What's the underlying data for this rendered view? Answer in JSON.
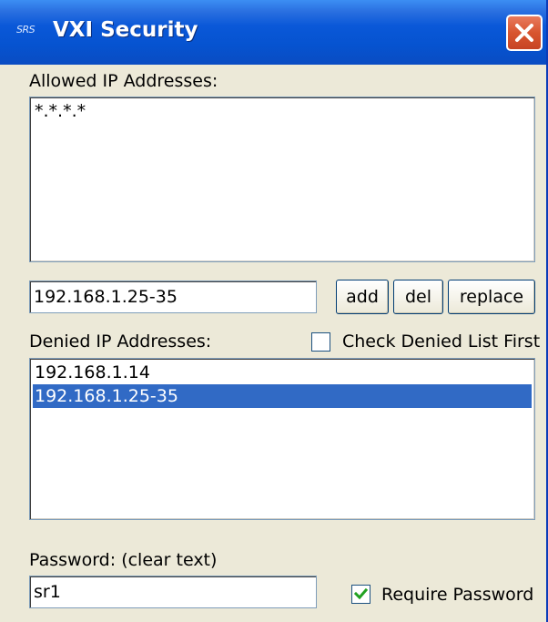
{
  "window": {
    "title": "VXI Security",
    "logo_text": "SRS"
  },
  "allowed": {
    "label": "Allowed IP Addresses:",
    "items": [
      "*.*.*.*"
    ]
  },
  "address_input": {
    "value": "192.168.1.25-35"
  },
  "buttons": {
    "add": "add",
    "del": "del",
    "replace": "replace"
  },
  "denied": {
    "label": "Denied IP Addresses:",
    "items": [
      "192.168.1.14",
      "192.168.1.25-35"
    ],
    "selected_index": 1
  },
  "check_denied_first": {
    "label": "Check Denied List First",
    "checked": false
  },
  "password": {
    "label": "Password: (clear text)",
    "value": "sr1"
  },
  "require_password": {
    "label": "Require Password",
    "checked": true
  },
  "colors": {
    "titlebar": "#0653d0",
    "selection": "#316ac5",
    "close_button": "#d8552f",
    "dialog_background": "#ece9d8"
  }
}
